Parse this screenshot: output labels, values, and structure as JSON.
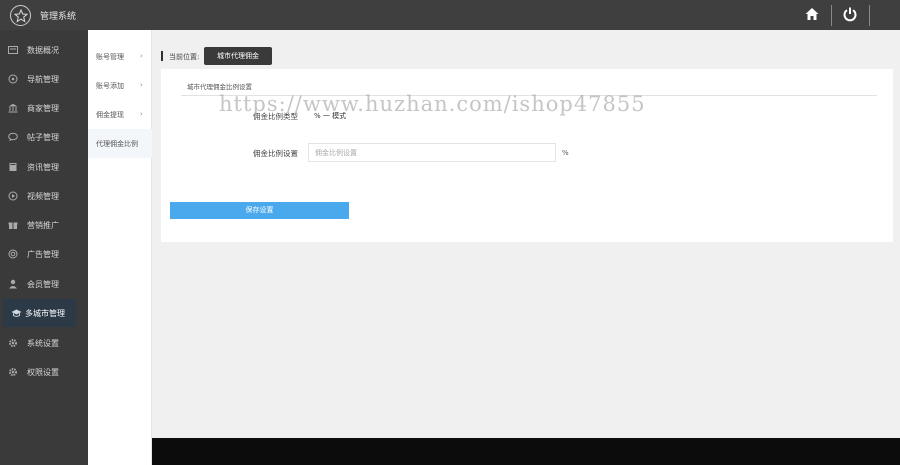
{
  "topbar": {
    "app_title": "管理系统",
    "icons": [
      "star-icon",
      "home-icon",
      "power-icon"
    ]
  },
  "sidebar": {
    "items": [
      {
        "label": "数据概况",
        "icon": "dashboard-icon"
      },
      {
        "label": "导航管理",
        "icon": "compass-icon"
      },
      {
        "label": "商家管理",
        "icon": "bank-icon"
      },
      {
        "label": "帖子管理",
        "icon": "chat-icon"
      },
      {
        "label": "资讯管理",
        "icon": "book-icon"
      },
      {
        "label": "视频管理",
        "icon": "play-icon"
      },
      {
        "label": "营销推广",
        "icon": "gift-icon"
      },
      {
        "label": "广告管理",
        "icon": "target-icon"
      },
      {
        "label": "会员管理",
        "icon": "user-icon"
      },
      {
        "label": "多城市管理",
        "icon": "graduation-cap-icon",
        "active": true
      },
      {
        "label": "系统设置",
        "icon": "gear-icon"
      },
      {
        "label": "权限设置",
        "icon": "gear-icon"
      }
    ]
  },
  "subnav": {
    "items": [
      {
        "label": "账号管理",
        "chevron": "›"
      },
      {
        "label": "账号添加",
        "chevron": "›"
      },
      {
        "label": "佣金提现",
        "chevron": "›"
      },
      {
        "label": "代理佣金比例",
        "chevron": "",
        "active": true
      }
    ]
  },
  "breadcrumb": {
    "label": "当前位置:",
    "current": "城市代理佣金"
  },
  "form": {
    "section_title": "城市代理佣金比例设置",
    "row1_label": "佣金比例类型",
    "row1_value": "% 一 模式",
    "row2_label": "佣金比例设置",
    "row2_placeholder": "佣金比例设置",
    "row2_value": "",
    "unit": "%",
    "save_label": "保存设置"
  },
  "watermark": "https://www.huzhan.com/ishop47855",
  "colors": {
    "topbar": "#3f3f3f",
    "sidebar": "#3a3a3a",
    "active_nav": "#2c3a48",
    "accent": "#4aa8ec"
  }
}
